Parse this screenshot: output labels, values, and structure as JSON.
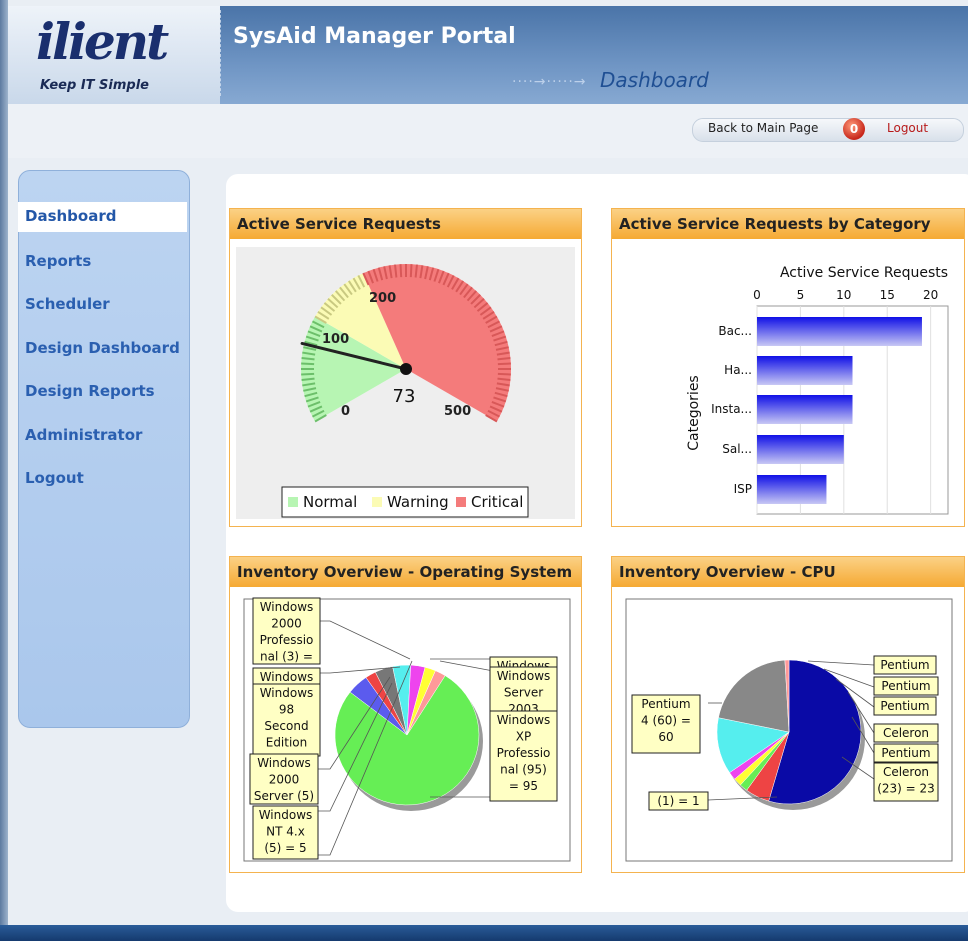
{
  "header": {
    "logo_text": "ilient",
    "tagline": "Keep IT Simple",
    "portal_title": "SysAid Manager Portal",
    "page_name": "Dashboard",
    "arrows": "····→·····→"
  },
  "toplinks": {
    "back": "Back to Main Page",
    "logout_icon": "0",
    "logout": "Logout"
  },
  "sidebar": {
    "items": [
      {
        "label": "Dashboard",
        "active": true
      },
      {
        "label": "Reports"
      },
      {
        "label": "Scheduler"
      },
      {
        "label": "Design Dashboard"
      },
      {
        "label": "Design Reports"
      },
      {
        "label": "Administrator"
      },
      {
        "label": "Logout"
      }
    ]
  },
  "panels": {
    "gauge_title": "Active Service Requests",
    "bar_title": "Active Service Requests by Category",
    "os_title": "Inventory Overview - Operating System",
    "cpu_title": "Inventory Overview - CPU"
  },
  "chart_data": [
    {
      "type": "gauge",
      "title": "Active Service Requests",
      "value": 73,
      "value_label": "73",
      "scale": {
        "min": 0,
        "max": 500
      },
      "tick_labels": [
        "0",
        "100",
        "200",
        "500"
      ],
      "bands": [
        {
          "name": "Normal",
          "from": 0,
          "to": 100,
          "color": "#b7f5b3"
        },
        {
          "name": "Warning",
          "from": 100,
          "to": 200,
          "color": "#fbfbb5"
        },
        {
          "name": "Critical",
          "from": 200,
          "to": 500,
          "color": "#f47b7b"
        }
      ],
      "legend": [
        "Normal",
        "Warning",
        "Critical"
      ],
      "legend_position": "bottom"
    },
    {
      "type": "bar",
      "orientation": "horizontal",
      "title": "Active Service Requests",
      "xlabel": "Active Service Requests",
      "ylabel": "Categories",
      "xlim": [
        0,
        22
      ],
      "x_ticks": [
        "0",
        "5",
        "10",
        "15",
        "20"
      ],
      "categories": [
        "Bac...",
        "Ha...",
        "Insta...",
        "Sal...",
        "ISP"
      ],
      "values": [
        19,
        11,
        11,
        10,
        8
      ],
      "grid": true
    },
    {
      "type": "pie",
      "title": "Inventory Overview - Operating System",
      "slices": [
        {
          "label": "Windows XP Professional (95) = 95",
          "value": 95,
          "color": "#66ee55"
        },
        {
          "label": "Windows Server 2003",
          "value": 6,
          "color": "#5b5bee"
        },
        {
          "label": "Windows",
          "value": 3,
          "color": "#ee4444"
        },
        {
          "label": "Windows NT 4.x (5) = 5",
          "value": 5,
          "color": "#777777"
        },
        {
          "label": "Windows 2000 Server (5)",
          "value": 5,
          "color": "#55eeee"
        },
        {
          "label": "Windows 98 Second Edition",
          "value": 4,
          "color": "#ee44ee"
        },
        {
          "label": "Windows",
          "value": 3,
          "color": "#ffff33"
        },
        {
          "label": "Windows 2000 Professional (3) =",
          "value": 3,
          "color": "#ff9999"
        }
      ],
      "left_labels": [
        "Windows 2000 Professio nal (3) =",
        "Windows",
        "Windows 98 Second Edition",
        "Windows 2000 Server (5)",
        "Windows NT 4.x (5) = 5"
      ],
      "right_labels": [
        "Windows",
        "Windows Server 2003",
        "Windows XP Professio nal (95) = 95"
      ]
    },
    {
      "type": "pie",
      "title": "Inventory Overview - CPU",
      "slices": [
        {
          "label": "Pentium 4 (60) = 60",
          "value": 60,
          "color": "#0a0aa6"
        },
        {
          "label": "Pentium",
          "value": 6,
          "color": "#ee4444"
        },
        {
          "label": "Pentium",
          "value": 2,
          "color": "#66ee55"
        },
        {
          "label": "Pentium",
          "value": 2,
          "color": "#ffff33"
        },
        {
          "label": "Celeron",
          "value": 2,
          "color": "#ee44ee"
        },
        {
          "label": "Pentium",
          "value": 14,
          "color": "#55eeee"
        },
        {
          "label": "Celeron (23) = 23",
          "value": 23,
          "color": "#888888"
        },
        {
          "label": "(1) = 1",
          "value": 1,
          "color": "#ff9999"
        }
      ],
      "left_labels": [
        "Pentium 4 (60) = 60",
        "(1) = 1"
      ],
      "right_labels": [
        "Pentium",
        "Pentium",
        "Pentium",
        "Celeron",
        "Pentium",
        "Celeron (23) = 23"
      ]
    }
  ]
}
